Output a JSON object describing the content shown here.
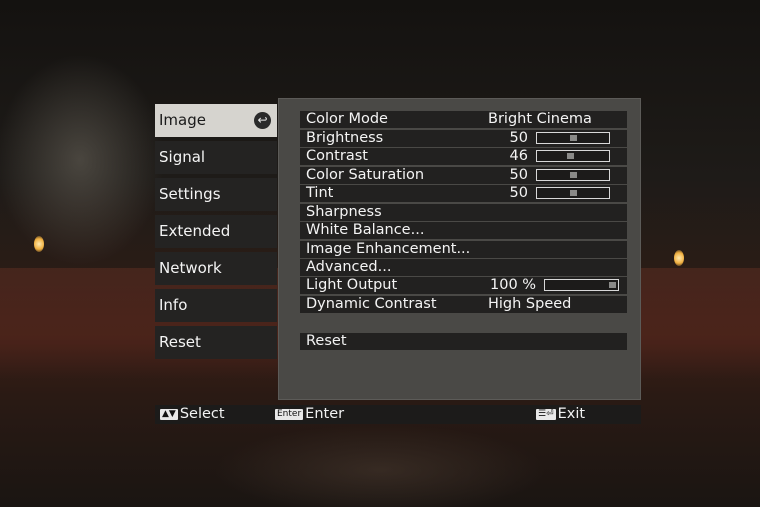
{
  "nav": {
    "items": [
      {
        "label": "Image",
        "active": true
      },
      {
        "label": "Signal"
      },
      {
        "label": "Settings"
      },
      {
        "label": "Extended"
      },
      {
        "label": "Network"
      },
      {
        "label": "Info"
      },
      {
        "label": "Reset"
      }
    ]
  },
  "settings": {
    "color_mode": {
      "label": "Color Mode",
      "value": "Bright Cinema"
    },
    "brightness": {
      "label": "Brightness",
      "value": "50",
      "level": 50
    },
    "contrast": {
      "label": "Contrast",
      "value": "46",
      "level": 46
    },
    "color_saturation": {
      "label": "Color Saturation",
      "value": "50",
      "level": 50
    },
    "tint": {
      "label": "Tint",
      "value": "50",
      "level": 50
    },
    "sharpness": {
      "label": "Sharpness"
    },
    "white_balance": {
      "label": "White Balance..."
    },
    "image_enhancement": {
      "label": "Image Enhancement..."
    },
    "advanced": {
      "label": "Advanced..."
    },
    "light_output": {
      "label": "Light Output",
      "value": "100 %",
      "level": 100
    },
    "dynamic_contrast": {
      "label": "Dynamic Contrast",
      "value": "High Speed"
    },
    "reset": {
      "label": "Reset"
    }
  },
  "footer": {
    "select_key": "▲▼",
    "select": "Select",
    "enter_key": "Enter",
    "enter": "Enter",
    "exit_key": "☰⏎",
    "exit": "Exit"
  },
  "colors": {
    "panel": "#4a4946",
    "row": "#222120",
    "active_tab": "#d6d4cf"
  },
  "icons": {
    "active_tab": "enter-check-icon"
  }
}
